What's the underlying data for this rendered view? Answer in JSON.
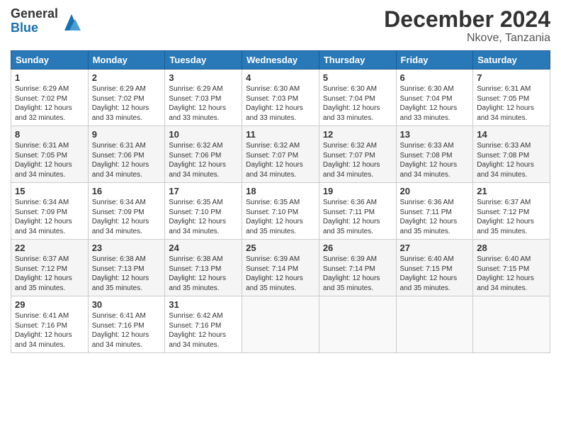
{
  "logo": {
    "general": "General",
    "blue": "Blue"
  },
  "title": "December 2024",
  "location": "Nkove, Tanzania",
  "headers": [
    "Sunday",
    "Monday",
    "Tuesday",
    "Wednesday",
    "Thursday",
    "Friday",
    "Saturday"
  ],
  "weeks": [
    [
      {
        "day": "1",
        "sunrise": "6:29 AM",
        "sunset": "7:02 PM",
        "daylight": "12 hours and 32 minutes."
      },
      {
        "day": "2",
        "sunrise": "6:29 AM",
        "sunset": "7:02 PM",
        "daylight": "12 hours and 33 minutes."
      },
      {
        "day": "3",
        "sunrise": "6:29 AM",
        "sunset": "7:03 PM",
        "daylight": "12 hours and 33 minutes."
      },
      {
        "day": "4",
        "sunrise": "6:30 AM",
        "sunset": "7:03 PM",
        "daylight": "12 hours and 33 minutes."
      },
      {
        "day": "5",
        "sunrise": "6:30 AM",
        "sunset": "7:04 PM",
        "daylight": "12 hours and 33 minutes."
      },
      {
        "day": "6",
        "sunrise": "6:30 AM",
        "sunset": "7:04 PM",
        "daylight": "12 hours and 33 minutes."
      },
      {
        "day": "7",
        "sunrise": "6:31 AM",
        "sunset": "7:05 PM",
        "daylight": "12 hours and 34 minutes."
      }
    ],
    [
      {
        "day": "8",
        "sunrise": "6:31 AM",
        "sunset": "7:05 PM",
        "daylight": "12 hours and 34 minutes."
      },
      {
        "day": "9",
        "sunrise": "6:31 AM",
        "sunset": "7:06 PM",
        "daylight": "12 hours and 34 minutes."
      },
      {
        "day": "10",
        "sunrise": "6:32 AM",
        "sunset": "7:06 PM",
        "daylight": "12 hours and 34 minutes."
      },
      {
        "day": "11",
        "sunrise": "6:32 AM",
        "sunset": "7:07 PM",
        "daylight": "12 hours and 34 minutes."
      },
      {
        "day": "12",
        "sunrise": "6:32 AM",
        "sunset": "7:07 PM",
        "daylight": "12 hours and 34 minutes."
      },
      {
        "day": "13",
        "sunrise": "6:33 AM",
        "sunset": "7:08 PM",
        "daylight": "12 hours and 34 minutes."
      },
      {
        "day": "14",
        "sunrise": "6:33 AM",
        "sunset": "7:08 PM",
        "daylight": "12 hours and 34 minutes."
      }
    ],
    [
      {
        "day": "15",
        "sunrise": "6:34 AM",
        "sunset": "7:09 PM",
        "daylight": "12 hours and 34 minutes."
      },
      {
        "day": "16",
        "sunrise": "6:34 AM",
        "sunset": "7:09 PM",
        "daylight": "12 hours and 34 minutes."
      },
      {
        "day": "17",
        "sunrise": "6:35 AM",
        "sunset": "7:10 PM",
        "daylight": "12 hours and 34 minutes."
      },
      {
        "day": "18",
        "sunrise": "6:35 AM",
        "sunset": "7:10 PM",
        "daylight": "12 hours and 35 minutes."
      },
      {
        "day": "19",
        "sunrise": "6:36 AM",
        "sunset": "7:11 PM",
        "daylight": "12 hours and 35 minutes."
      },
      {
        "day": "20",
        "sunrise": "6:36 AM",
        "sunset": "7:11 PM",
        "daylight": "12 hours and 35 minutes."
      },
      {
        "day": "21",
        "sunrise": "6:37 AM",
        "sunset": "7:12 PM",
        "daylight": "12 hours and 35 minutes."
      }
    ],
    [
      {
        "day": "22",
        "sunrise": "6:37 AM",
        "sunset": "7:12 PM",
        "daylight": "12 hours and 35 minutes."
      },
      {
        "day": "23",
        "sunrise": "6:38 AM",
        "sunset": "7:13 PM",
        "daylight": "12 hours and 35 minutes."
      },
      {
        "day": "24",
        "sunrise": "6:38 AM",
        "sunset": "7:13 PM",
        "daylight": "12 hours and 35 minutes."
      },
      {
        "day": "25",
        "sunrise": "6:39 AM",
        "sunset": "7:14 PM",
        "daylight": "12 hours and 35 minutes."
      },
      {
        "day": "26",
        "sunrise": "6:39 AM",
        "sunset": "7:14 PM",
        "daylight": "12 hours and 35 minutes."
      },
      {
        "day": "27",
        "sunrise": "6:40 AM",
        "sunset": "7:15 PM",
        "daylight": "12 hours and 35 minutes."
      },
      {
        "day": "28",
        "sunrise": "6:40 AM",
        "sunset": "7:15 PM",
        "daylight": "12 hours and 34 minutes."
      }
    ],
    [
      {
        "day": "29",
        "sunrise": "6:41 AM",
        "sunset": "7:16 PM",
        "daylight": "12 hours and 34 minutes."
      },
      {
        "day": "30",
        "sunrise": "6:41 AM",
        "sunset": "7:16 PM",
        "daylight": "12 hours and 34 minutes."
      },
      {
        "day": "31",
        "sunrise": "6:42 AM",
        "sunset": "7:16 PM",
        "daylight": "12 hours and 34 minutes."
      },
      null,
      null,
      null,
      null
    ]
  ]
}
